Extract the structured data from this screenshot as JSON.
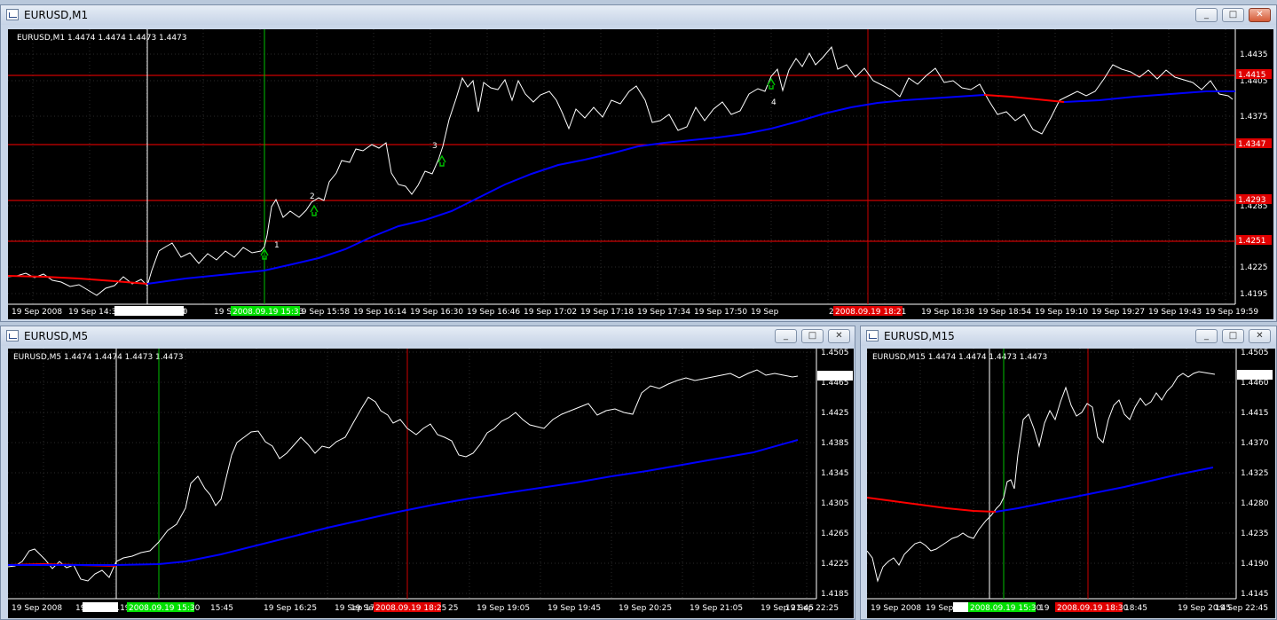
{
  "windows": {
    "m1": {
      "title": "EURUSD,M1",
      "info": "EURUSD,M1  1.4474 1.4474 1.4473 1.4473",
      "price_labels": [
        "1.4435",
        "1.4405",
        "1.4375",
        "1.4285",
        "1.4255",
        "1.4225",
        "1.4195"
      ],
      "level_labels": [
        "1.4415",
        "1.4347",
        "1.4293",
        "1.4251"
      ],
      "time_labels": [
        "19 Sep 2008",
        "19 Sep 14:3",
        "19 Sep 15:10",
        "19 Sep 15:42",
        "19 Sep 15:58",
        "19 Sep 16:14",
        "19 Sep 16:30",
        "19 Sep 16:46",
        "19 Sep 17:02",
        "19 Sep 17:18",
        "19 Sep 17:34",
        "19 Sep 17:50",
        "19 Sep",
        "22",
        "19 Sep 18:38",
        "19 Sep 18:54",
        "19 Sep 19:10",
        "19 Sep 19:27",
        "19 Sep 19:43",
        "19 Sep 19:59"
      ],
      "vline_labels": [
        "2008.09.19 15:00",
        "2008.09.19 15:33",
        "2008.09.19 18:21"
      ],
      "signals": [
        "1",
        "2",
        "3",
        "4"
      ]
    },
    "m5": {
      "title": "EURUSD,M5",
      "info": "EURUSD,M5  1.4474 1.4474 1.4473 1.4473",
      "price_labels": [
        "1.4505",
        "1.4465",
        "1.4425",
        "1.4385",
        "1.4345",
        "1.4305",
        "1.4265",
        "1.4225",
        "1.4185"
      ],
      "current_price": "1.4473",
      "time_labels": [
        "19 Sep 2008",
        "19 S",
        "15:45",
        "19 Sep 16:25",
        "19 Sep 17:05",
        "19 Se",
        "25",
        "19 Sep 19:05",
        "19 Sep 19:45",
        "19 Sep 20:25",
        "19 Sep 21:05",
        "19 Sep 21:45",
        "19 Sep 22:25"
      ],
      "vline_labels": [
        "2008.09.19",
        "2008.09.19 15:30",
        "2008.09.19 18:25"
      ]
    },
    "m15": {
      "title": "EURUSD,M15",
      "info": "EURUSD,M15  1.4474 1.4474 1.4473 1.4473",
      "price_labels": [
        "1.4505",
        "1.4460",
        "1.4415",
        "1.4370",
        "1.4325",
        "1.4280",
        "1.4235",
        "1.4190",
        "1.4145"
      ],
      "current_price": "1.4473",
      "time_labels": [
        "19 Sep 2008",
        "19 Sep",
        "19",
        "18:45",
        "19 Sep 20:45",
        "19 Sep 22:45"
      ],
      "vline_labels": [
        "",
        "2008.09.19 15:30",
        "2008.09.19 18:30"
      ]
    }
  },
  "colors": {
    "price": "#ffffff",
    "ma_up": "#0000ff",
    "ma_down": "#ff0000",
    "level": "#ff0000",
    "vline_white": "#ffffff",
    "vline_green": "#00c000",
    "vline_red": "#cc0000",
    "arrow": "#00c000"
  }
}
